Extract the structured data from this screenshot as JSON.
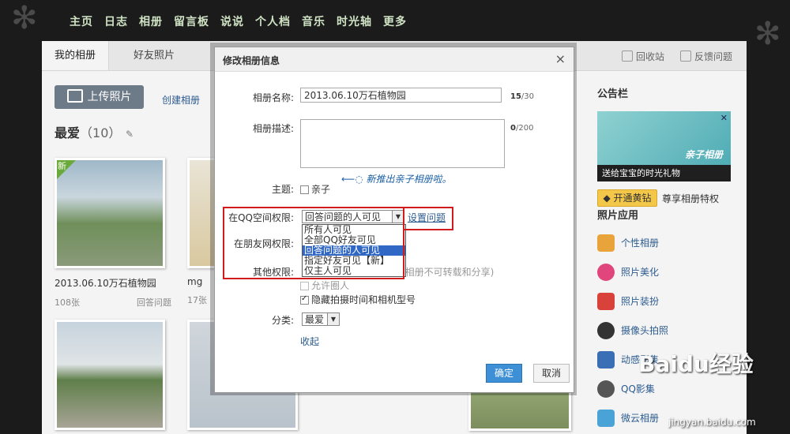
{
  "nav": [
    "主页",
    "日志",
    "相册",
    "留言板",
    "说说",
    "个人档",
    "音乐",
    "时光轴",
    "更多"
  ],
  "tabs": [
    "我的相册",
    "好友照片"
  ],
  "top_right": {
    "recycle": "回收站",
    "feedback": "反馈问题"
  },
  "upload_label": "上传照片",
  "create_album": "创建相册",
  "favorites": {
    "title": "最爱",
    "count": "（10）"
  },
  "albums": [
    {
      "name": "2013.06.10万石植物园",
      "count": "108张",
      "status": "回答问题",
      "badge": "新"
    },
    {
      "name": "mg",
      "count": "17张",
      "status": ""
    }
  ],
  "sidebar": {
    "notice_title": "公告栏",
    "banner_caption": "送给宝宝的时光礼物",
    "banner_logo": "亲子相册",
    "vip_button": "开通黄钻",
    "vip_text": "尊享相册特权",
    "apps_title": "照片应用",
    "apps": [
      {
        "label": "个性相册",
        "color": "#e8a43a"
      },
      {
        "label": "照片美化",
        "color": "#e0457b"
      },
      {
        "label": "照片装扮",
        "color": "#d9423a"
      },
      {
        "label": "摄像头拍照",
        "color": "#333333"
      },
      {
        "label": "动感影集",
        "color": "#3a6fb5"
      },
      {
        "label": "QQ影集",
        "color": "#555555"
      },
      {
        "label": "微云相册",
        "color": "#4aa3d6"
      }
    ]
  },
  "dialog": {
    "title": "修改相册信息",
    "close": "×",
    "name_label": "相册名称:",
    "name_value": "2013.06.10万石植物园",
    "name_count": "15",
    "name_max": "/30",
    "desc_label": "相册描述:",
    "desc_count": "0",
    "desc_max": "/200",
    "theme_label": "主题:",
    "theme_option": "亲子",
    "handwriting": "新推出亲子相册啦。",
    "qq_perm_label": "在QQ空间权限:",
    "qq_perm_value": "回答问题的人可见",
    "set_question": "设置问题",
    "perm_options": [
      "所有人可见",
      "全部QQ好友可见",
      "回答问题的人可见",
      "指定好友可见【新】",
      "仅主人可见"
    ],
    "friend_perm_label": "在朋友网权限:",
    "other_perm_label": "其他权限:",
    "other_hint": "(相册不可转载和分享)",
    "allow_circle": "允许圈人",
    "hide_camera": "隐藏拍摄时间和相机型号",
    "category_label": "分类:",
    "category_value": "最爱",
    "collapse": "收起",
    "ok": "确定",
    "cancel": "取消"
  },
  "watermark": {
    "main": "Baidu经验",
    "sub": "jingyan.baidu.com"
  }
}
